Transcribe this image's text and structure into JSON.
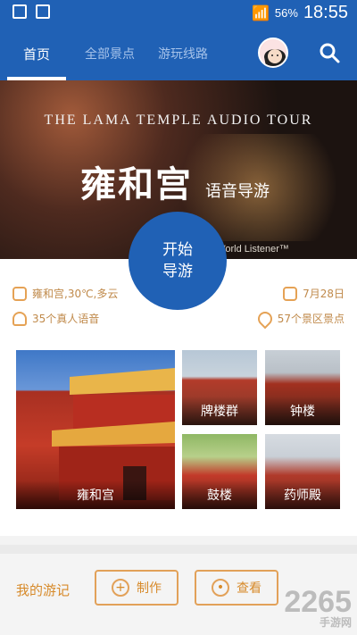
{
  "status_bar": {
    "battery": "56%",
    "time": "18:55"
  },
  "nav": {
    "tabs": [
      {
        "label": "首页"
      },
      {
        "label": "全部景点"
      },
      {
        "label": "游玩线路"
      }
    ]
  },
  "banner": {
    "title_en": "THE LAMA TEMPLE AUDIO TOUR",
    "title_cn": "雍和宫",
    "title_cn_sub": "语音导游",
    "credit": "m World Listener™"
  },
  "start_button": {
    "line1": "开始",
    "line2": "导游"
  },
  "info": {
    "weather": "雍和宫,30℃,多云",
    "date": "7月28日",
    "voices": "35个真人语音",
    "spots": "57个景区景点"
  },
  "attractions": [
    {
      "label": "雍和宫"
    },
    {
      "label": "牌楼群"
    },
    {
      "label": "钟楼"
    },
    {
      "label": "鼓楼"
    },
    {
      "label": "药师殿"
    }
  ],
  "travelogue": {
    "title": "我的游记",
    "make_label": "制作",
    "view_label": "查看"
  },
  "watermark": {
    "brand": "2265",
    "sub": "手游网"
  }
}
